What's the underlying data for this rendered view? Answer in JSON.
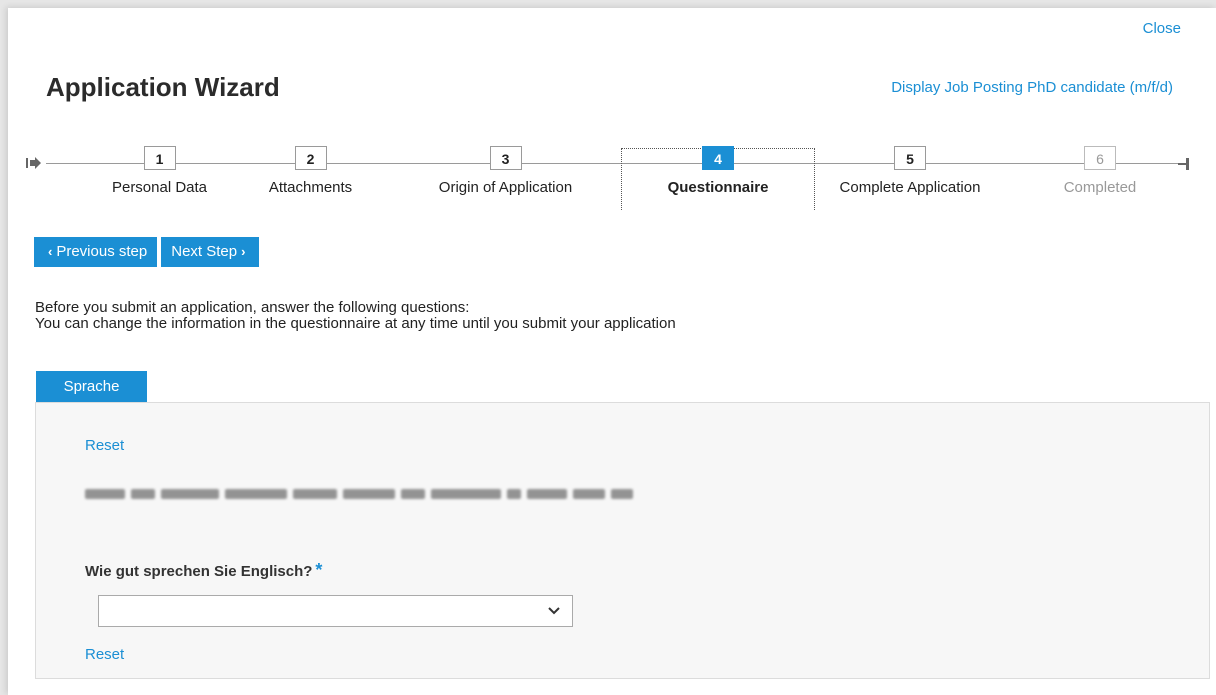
{
  "dialog": {
    "close_label": "Close",
    "title": "Application Wizard",
    "job_link_label": "Display Job Posting",
    "job_posting_title": "PhD candidate (m/f/d)"
  },
  "stepper": {
    "steps": [
      {
        "number": "1",
        "label": "Personal Data",
        "state": "done"
      },
      {
        "number": "2",
        "label": "Attachments",
        "state": "done"
      },
      {
        "number": "3",
        "label": "Origin of Application",
        "state": "done"
      },
      {
        "number": "4",
        "label": "Questionnaire",
        "state": "active"
      },
      {
        "number": "5",
        "label": "Complete Application",
        "state": "pending"
      },
      {
        "number": "6",
        "label": "Completed",
        "state": "disabled"
      }
    ]
  },
  "nav": {
    "previous_label": "Previous step",
    "next_label": "Next Step"
  },
  "intro": {
    "line1": "Before you submit an application, answer the following questions:",
    "line2": "You can change the information in the questionnaire at any time until you submit your application"
  },
  "questionnaire": {
    "tab_label": "Sprache",
    "reset_label": "Reset",
    "question_label": "Wie gut sprechen Sie Englisch?",
    "required_marker": "*",
    "select_value": ""
  },
  "colors": {
    "accent": "#1b8fd4",
    "panel_bg": "#f7f7f7"
  },
  "icons": {
    "start": "step-start-icon",
    "end": "step-end-icon",
    "previous": "chevron-left-icon",
    "next": "chevron-right-icon",
    "dropdown": "chevron-down-icon"
  }
}
